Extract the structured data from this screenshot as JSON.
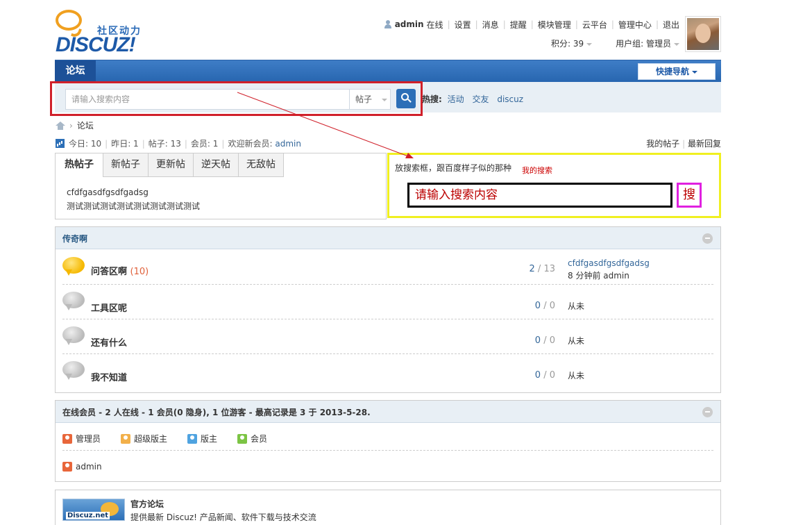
{
  "header": {
    "logo": {
      "subtitle": "社区动力",
      "brand": "DISCUZ!"
    },
    "user": {
      "name": "admin",
      "status": "在线",
      "links": [
        "设置",
        "消息",
        "提醒",
        "模块管理",
        "云平台",
        "管理中心",
        "退出"
      ]
    },
    "credits_label": "积分: 39",
    "group_label": "用户组: 管理员"
  },
  "nav": {
    "forum_tab": "论坛",
    "quick_nav": "快捷导航"
  },
  "search": {
    "placeholder": "请输入搜索内容",
    "type": "帖子",
    "hot_label": "热搜:",
    "hot_terms": [
      "活动",
      "交友",
      "discuz"
    ]
  },
  "breadcrumb": {
    "current": "论坛"
  },
  "stats": {
    "today": "今日: 10",
    "yesterday": "昨日: 1",
    "posts": "帖子: 13",
    "members": "会员: 1",
    "welcome": "欢迎新会员:",
    "newest": "admin",
    "my_posts": "我的帖子",
    "latest_replies": "最新回复"
  },
  "hot_tabs": {
    "tabs": [
      "热帖子",
      "新帖子",
      "更新帖",
      "逆天帖",
      "无敌帖"
    ],
    "active": 0,
    "content_line1": "cfdfgasdfgsdfgadsg",
    "content_line2": "测试测试测试测试测试测试测试测试"
  },
  "annotation": {
    "note": "放搜索框，跟百度样子似的那种",
    "label": "我的搜索",
    "input_text": "请输入搜索内容",
    "button_text": "搜",
    "box_color": "#f0f020",
    "arrow_color": "#d0202a"
  },
  "forum_group": {
    "title": "传奇啊",
    "forums": [
      {
        "name": "问答区啊",
        "today": "(10)",
        "threads": "2",
        "posts": "13",
        "last_title": "cfdfgasdfgsdfgadsg",
        "last_meta": "8 分钟前 admin",
        "active": true
      },
      {
        "name": "工具区呢",
        "today": "",
        "threads": "0",
        "posts": "0",
        "last_title": "",
        "last_meta": "从未",
        "active": false
      },
      {
        "name": "还有什么",
        "today": "",
        "threads": "0",
        "posts": "0",
        "last_title": "",
        "last_meta": "从未",
        "active": false
      },
      {
        "name": "我不知道",
        "today": "",
        "threads": "0",
        "posts": "0",
        "last_title": "",
        "last_meta": "从未",
        "active": false
      }
    ]
  },
  "online": {
    "title": "在线会员 - 2 人在线 - 1 会员(0 隐身), 1 位游客 - 最高记录是 3 于 2013-5-28.",
    "legend": [
      {
        "label": "管理员",
        "color": "#e8663a"
      },
      {
        "label": "超级版主",
        "color": "#f2b04a"
      },
      {
        "label": "版主",
        "color": "#4fa3e0"
      },
      {
        "label": "会员",
        "color": "#7cc444"
      }
    ],
    "users": [
      "admin"
    ]
  },
  "official": {
    "logo_text": "Discuz.net",
    "title": "官方论坛",
    "desc": "提供最新 Discuz! 产品新闻、软件下载与技术交流"
  }
}
